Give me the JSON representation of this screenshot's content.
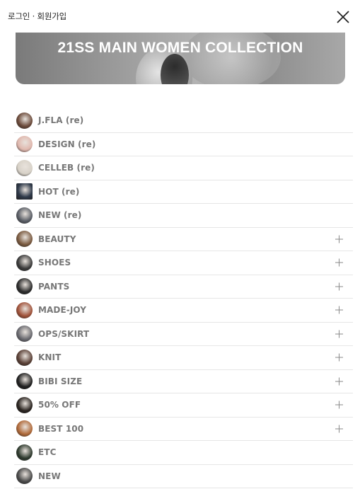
{
  "header": {
    "login_label": "로그인",
    "separator": " · ",
    "signup_label": "회원가입"
  },
  "banner": {
    "title": "21SS MAIN WOMEN COLLECTION"
  },
  "menu": {
    "items": [
      {
        "label": "J.FLA (re)",
        "expandable": false,
        "thumb_color": "#6b4a3a"
      },
      {
        "label": "DESIGN (re)",
        "expandable": false,
        "thumb_color": "#e0b8ae"
      },
      {
        "label": "CELLEB (re)",
        "expandable": false,
        "thumb_color": "#d8d2c8"
      },
      {
        "label": "HOT (re)",
        "expandable": false,
        "thumb_color": "#2f3a4a"
      },
      {
        "label": "NEW (re)",
        "expandable": false,
        "thumb_color": "#5a5e66"
      },
      {
        "label": "BEAUTY",
        "expandable": true,
        "thumb_color": "#7a5a40"
      },
      {
        "label": "SHOES",
        "expandable": true,
        "thumb_color": "#3a3a3a"
      },
      {
        "label": "PANTS",
        "expandable": true,
        "thumb_color": "#2c2c2c"
      },
      {
        "label": "MADE-JOY",
        "expandable": true,
        "thumb_color": "#a0523a"
      },
      {
        "label": "OPS/SKIRT",
        "expandable": true,
        "thumb_color": "#6a6a70"
      },
      {
        "label": "KNIT",
        "expandable": true,
        "thumb_color": "#5a4036"
      },
      {
        "label": "BIBI SIZE",
        "expandable": true,
        "thumb_color": "#1f1f1f"
      },
      {
        "label": "50% OFF",
        "expandable": true,
        "thumb_color": "#2a2420"
      },
      {
        "label": "BEST 100",
        "expandable": true,
        "thumb_color": "#b06a3a"
      },
      {
        "label": "ETC",
        "expandable": false,
        "thumb_color": "#2e3a2e"
      },
      {
        "label": "NEW",
        "expandable": false,
        "thumb_color": "#4a4a4a"
      }
    ]
  }
}
